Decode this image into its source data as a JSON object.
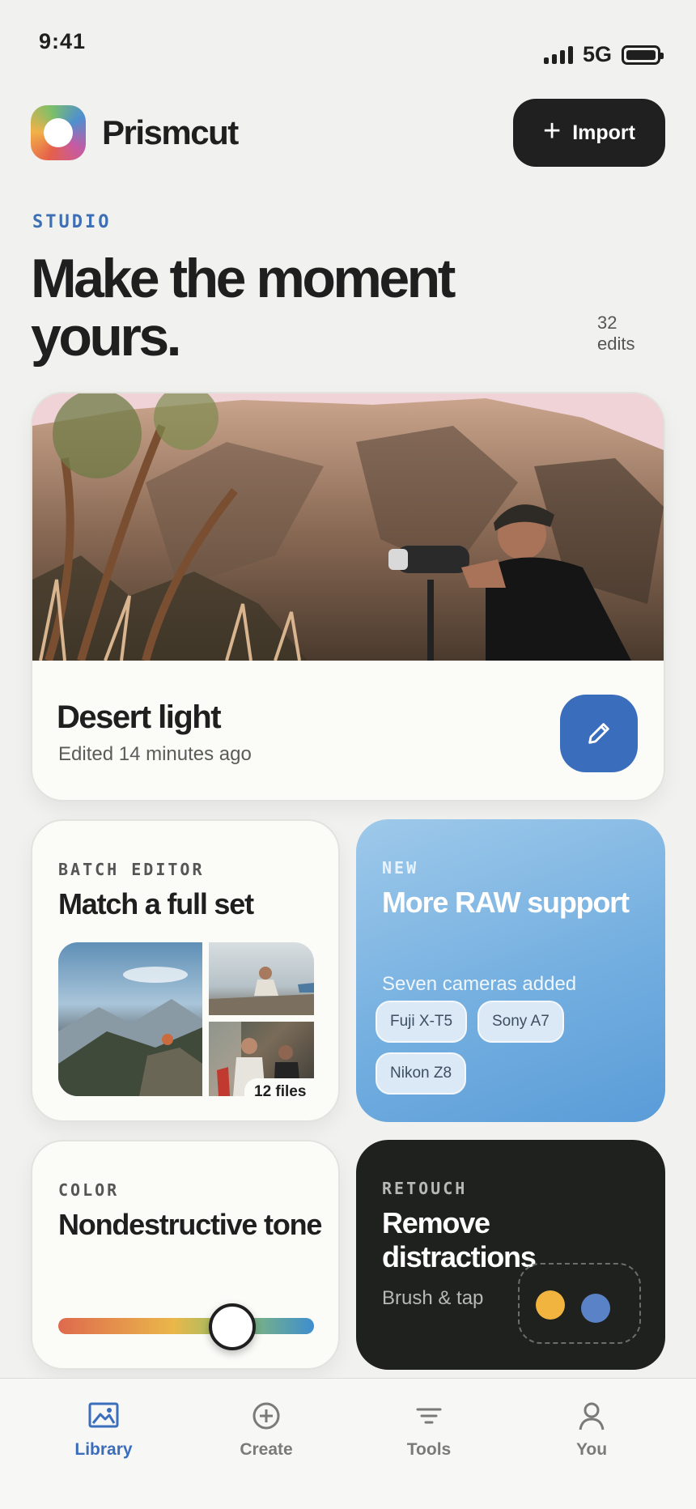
{
  "status": {
    "time": "9:41",
    "network": "5G"
  },
  "header": {
    "app_name": "Prismcut",
    "import_label": "Import"
  },
  "hero": {
    "eyebrow": "STUDIO",
    "title": "Make the moment yours.",
    "edits_count": "32",
    "edits_unit": "edits"
  },
  "feature": {
    "title": "Desert light",
    "subtitle": "Edited 14 minutes ago"
  },
  "batch": {
    "eyebrow": "BATCH EDITOR",
    "title": "Match a full set",
    "files_badge": "12 files"
  },
  "new_card": {
    "eyebrow": "NEW",
    "title": "More RAW support",
    "subtitle": "Seven cameras added",
    "chips": [
      "Fuji X-T5",
      "Sony A7",
      "Nikon Z8"
    ]
  },
  "color_card": {
    "eyebrow": "COLOR",
    "title": "Nondestructive tone",
    "slider_level": 0.68
  },
  "retouch": {
    "eyebrow": "RETOUCH",
    "title": "Remove distractions",
    "subtitle": "Brush & tap"
  },
  "tabs": [
    {
      "label": "Library",
      "icon": "image-icon",
      "active": true
    },
    {
      "label": "Create",
      "icon": "plus-circle-icon",
      "active": false
    },
    {
      "label": "Tools",
      "icon": "filter-icon",
      "active": false
    },
    {
      "label": "You",
      "icon": "person-icon",
      "active": false
    }
  ],
  "colors": {
    "accent": "#3b6dbd",
    "dark": "#1f201f",
    "background": "#f1f1f0"
  }
}
